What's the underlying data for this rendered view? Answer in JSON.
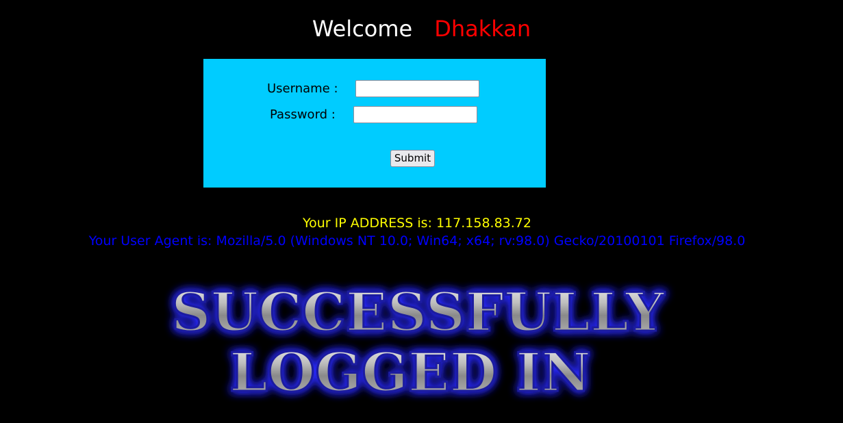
{
  "header": {
    "welcome": "Welcome",
    "name": "Dhakkan"
  },
  "login_form": {
    "username_label": "Username :",
    "username_value": "",
    "password_label": "Password :",
    "password_value": "",
    "submit_label": "Submit"
  },
  "info": {
    "ip_text": "Your IP ADDRESS is: 117.158.83.72",
    "user_agent_text": "Your User Agent is: Mozilla/5.0 (Windows NT 10.0; Win64; x64; rv:98.0) Gecko/20100101 Firefox/98.0"
  },
  "success_banner": {
    "line1": "SUCCESSFULLY",
    "line2": "LOGGED IN"
  },
  "colors": {
    "background": "#000000",
    "welcome": "#ffffff",
    "name": "#ff0000",
    "form_background": "#00ccff",
    "ip_text": "#ffff00",
    "user_agent_text": "#0000ff",
    "banner_glow": "#2a2aff"
  }
}
